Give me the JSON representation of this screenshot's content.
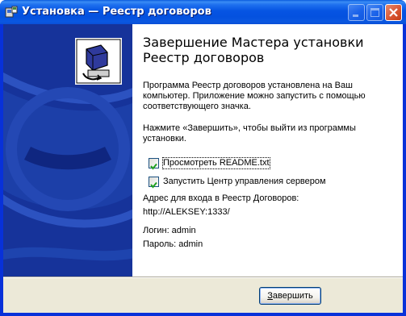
{
  "window": {
    "title": "Установка — Реестр договоров",
    "icon": "setup-icon",
    "buttons": [
      "minimize",
      "maximize",
      "close"
    ]
  },
  "sidebar": {
    "logo": "computer-box-icon"
  },
  "content": {
    "heading_line1": "Завершение Мастера установки",
    "heading_line2": "Реестр договоров",
    "para1_line1": "Программа Реестр договоров установлена на Ваш",
    "para1_line2": "компьютер. Приложение можно запустить с помощью",
    "para1_line3": "соответствующего значка.",
    "para2_line1": "Нажмите «Завершить», чтобы выйти из программы",
    "para2_line2": "установки.",
    "checkboxes": [
      {
        "label": "Просмотреть README.txt",
        "checked": true
      },
      {
        "label": "Запустить Центр управления сервером",
        "checked": true
      }
    ],
    "address_label": "Адрес для входа в Реестр Договоров:",
    "address_value": "http://ALEKSEY:1333/",
    "login": "Логин: admin",
    "password": "Пароль: admin"
  },
  "footer": {
    "finish_label": "Завершить"
  },
  "colors": {
    "title_blue": "#0054e3",
    "sidebar_blue": "#16339a",
    "window_bg": "#ece9d8"
  }
}
